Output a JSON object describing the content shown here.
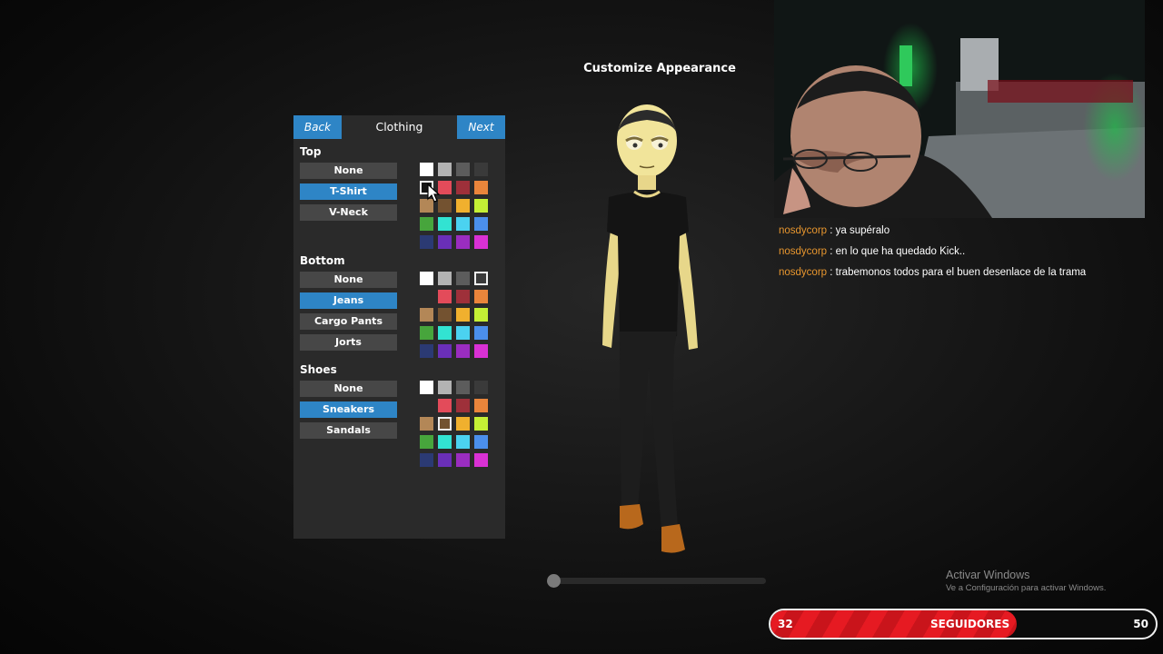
{
  "screen": {
    "title": "Customize Appearance"
  },
  "panel": {
    "back_label": "Back",
    "title": "Clothing",
    "next_label": "Next",
    "sections": [
      {
        "label": "Top",
        "options": [
          "None",
          "T-Shirt",
          "V-Neck"
        ],
        "selected_option": "T-Shirt",
        "palette": [
          [
            "#ffffff",
            "#b3b3b3",
            "#5c5c5c",
            "#3a3a3a"
          ],
          [
            "#141414",
            "#e34b5a",
            "#9e303a",
            "#e9853b"
          ],
          [
            "#b38757",
            "#735230",
            "#f0b02e",
            "#c4ef35"
          ],
          [
            "#47a53c",
            "#32e3d2",
            "#4bd2f0",
            "#4b8fec"
          ],
          [
            "#2b3a73",
            "#6a2fb8",
            "#9a2dc0",
            "#d931d4"
          ]
        ],
        "selected_color": "#141414"
      },
      {
        "label": "Bottom",
        "options": [
          "None",
          "Jeans",
          "Cargo Pants",
          "Jorts"
        ],
        "selected_option": "Jeans",
        "palette": [
          [
            "#ffffff",
            "#b3b3b3",
            "#5c5c5c",
            "#3a3a3a"
          ],
          [
            "#2a2a2a",
            "#e34b5a",
            "#9e303a",
            "#e9853b"
          ],
          [
            "#b38757",
            "#735230",
            "#f0b02e",
            "#c4ef35"
          ],
          [
            "#47a53c",
            "#32e3d2",
            "#4bd2f0",
            "#4b8fec"
          ],
          [
            "#2b3a73",
            "#6a2fb8",
            "#9a2dc0",
            "#d931d4"
          ]
        ],
        "selected_color": "#3a3a3a"
      },
      {
        "label": "Shoes",
        "options": [
          "None",
          "Sneakers",
          "Sandals"
        ],
        "selected_option": "Sneakers",
        "palette": [
          [
            "#ffffff",
            "#b3b3b3",
            "#5c5c5c",
            "#3a3a3a"
          ],
          [
            "#2a2a2a",
            "#e34b5a",
            "#9e303a",
            "#e9853b"
          ],
          [
            "#b38757",
            "#735230",
            "#f0b02e",
            "#c4ef35"
          ],
          [
            "#47a53c",
            "#32e3d2",
            "#4bd2f0",
            "#4b8fec"
          ],
          [
            "#2b3a73",
            "#6a2fb8",
            "#9a2dc0",
            "#d931d4"
          ]
        ],
        "selected_color": "#735230"
      }
    ]
  },
  "preview": {
    "rotation_fraction": 0.0
  },
  "chat": [
    {
      "user": "nosdycorp",
      "message": " : ya supéralo"
    },
    {
      "user": "nosdycorp",
      "message": " : en lo que ha quedado Kick.."
    },
    {
      "user": "nosdycorp",
      "message": " : trabemonos todos para el buen desenlace de la trama"
    }
  ],
  "watermark": {
    "line1": "Activar Windows",
    "line2": "Ve a Configuración para activar Windows."
  },
  "followers": {
    "current": "32",
    "label": "SEGUIDORES",
    "goal": "50",
    "progress": 0.64
  },
  "colors": {
    "accent": "#2e85c6",
    "panel_bg": "#2a2a2a",
    "chat_user": "#e8962e",
    "follower_bar": "#e61a22"
  }
}
